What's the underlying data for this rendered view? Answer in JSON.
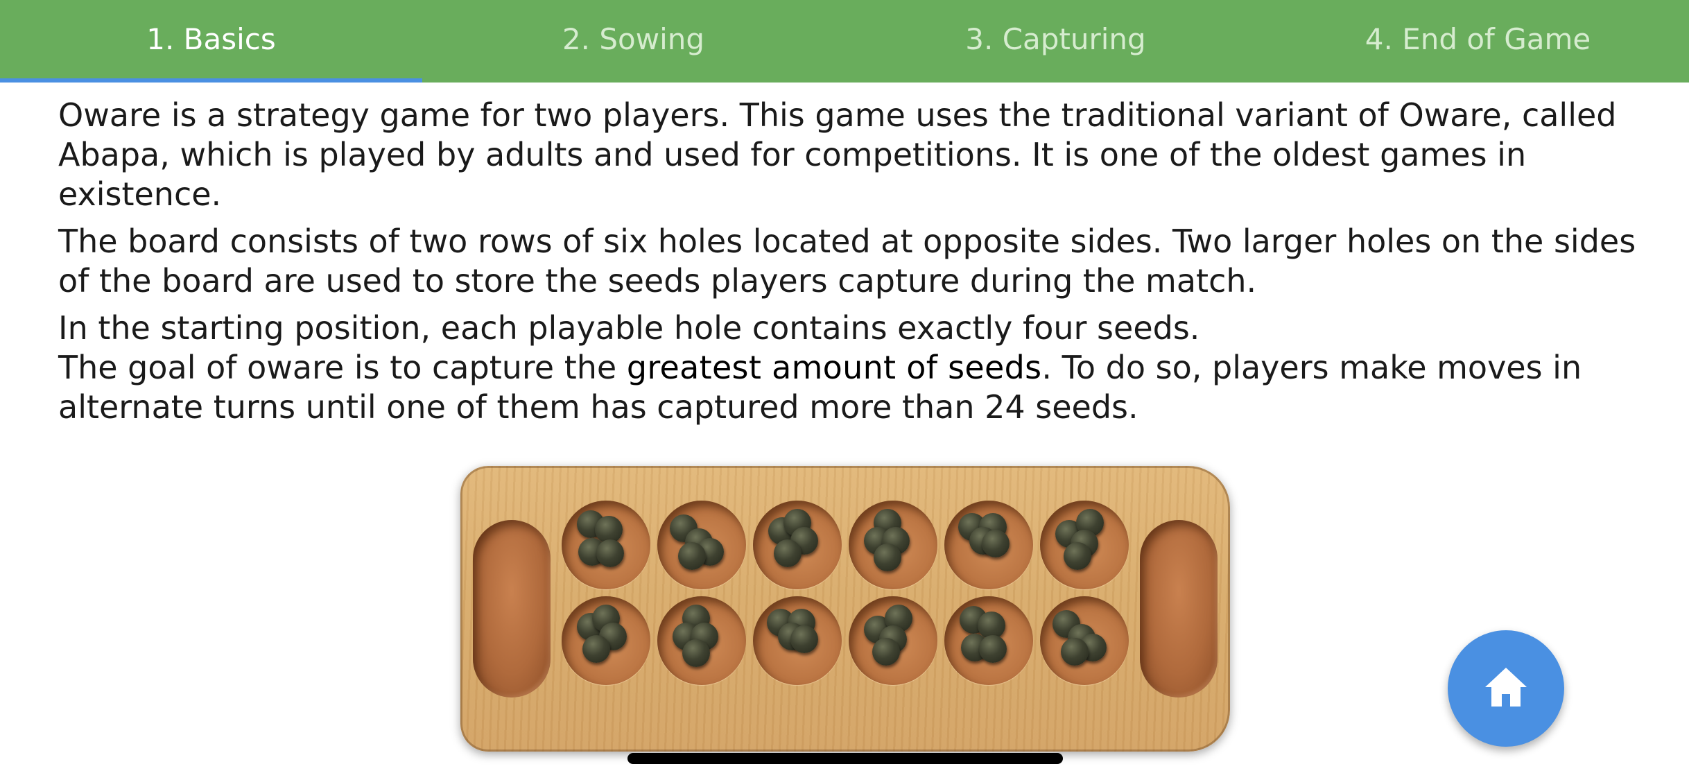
{
  "tabs": [
    {
      "label": "1. Basics",
      "active": true
    },
    {
      "label": "2. Sowing",
      "active": false
    },
    {
      "label": "3. Capturing",
      "active": false
    },
    {
      "label": "4. End of Game",
      "active": false
    }
  ],
  "content": {
    "paragraph1": "Oware is a strategy game for two players. This game uses the traditional variant of Oware, called Abapa, which is played by adults and used for competitions. It is one of the oldest games in existence.",
    "paragraph2": "The board consists of two rows of six holes located at opposite sides. Two larger holes on the sides of the board are used to store the seeds players capture during the match.",
    "paragraph3": "In the starting position, each playable hole contains exactly four seeds.",
    "goal_before": "The goal of oware is to capture the ",
    "goal_emphasis": "greatest amount of seeds",
    "goal_after": ". To do so, players make moves in alternate turns until one of them has captured more than 24 seeds."
  },
  "board": {
    "pits_per_row": 6,
    "rows": 2,
    "seeds_per_pit": 4,
    "stores": 2
  },
  "fab": {
    "icon": "home-icon"
  },
  "colors": {
    "tab_bar": "#69ad5c",
    "tab_indicator": "#4a90e2",
    "fab": "#4a90e2"
  }
}
